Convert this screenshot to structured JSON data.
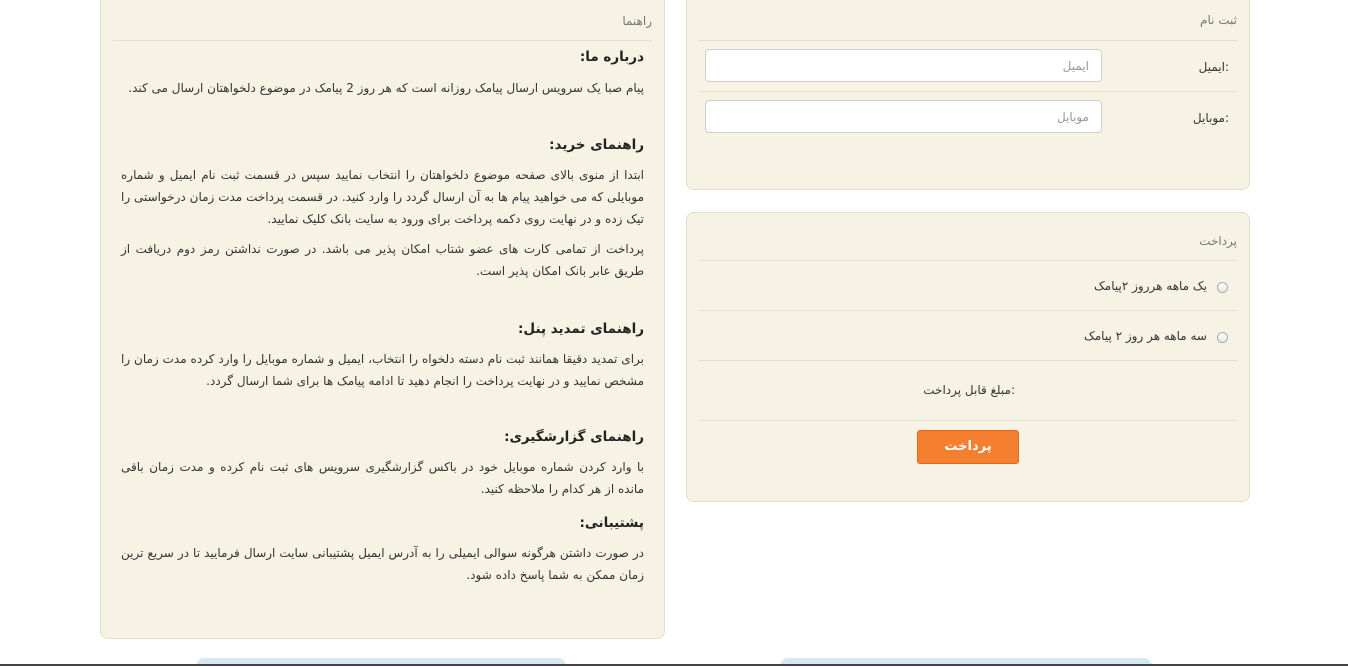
{
  "signup": {
    "title": "ثبت نام",
    "email_label": "ایمیل:",
    "email_placeholder": "ایمیل",
    "mobile_label": "موبایل:",
    "mobile_placeholder": "موبایل"
  },
  "payment": {
    "title": "پرداخت",
    "options": [
      "یک ماهه هرروز ۲پیامک",
      "سه ماهه هر روز ۲ پیامک"
    ],
    "amount_label": "مبلغ قابل پرداخت:",
    "pay_button": "پرداخت"
  },
  "guide": {
    "title": "راهنما",
    "about_heading": "درباره ما:",
    "about_text": "پیام صبا یک سرویس ارسال پیامک روزانه است که هر روز 2 پیامک در موضوع دلخواهتان ارسال می کند.",
    "buy_heading": "راهنمای خرید:",
    "buy_text_1": "ابتدا از منوی بالای صفحه موضوع دلخواهتان را انتخاب نمایید سپس در قسمت ثبت نام ایمیل و شماره موبایلی که می خواهید پیام ها به آن ارسال گردد را وارد کنید. در قسمت پرداخت مدت زمان درخواستی را تیک زده و در نهایت روی دکمه پرداخت برای ورود به سایت بانک کلیک نمایید.",
    "buy_text_2": "پرداخت از تمامی کارت های عضو شتاب امکان پذیر می باشد. در صورت نداشتن رمز دوم دریافت از طریق عابر بانک امکان پذیر است.",
    "renew_heading": "راهنمای تمدید پنل:",
    "renew_text": "برای تمدید دقیقا همانند ثبت نام دسته دلخواه را انتخاب، ایمیل و شماره موبایل را وارد کرده مدت زمان را مشخص نمایید و در نهایت پرداخت را انجام دهید تا ادامه پیامک ها برای شما ارسال گردد.",
    "report_heading": "راهنمای گزارشگیری:",
    "report_text": "با وارد کردن شماره موبایل خود در باکس گزارشگیری سرویس های ثبت نام کرده و مدت زمان باقی مانده از هر کدام را ملاحظه کنید.",
    "support_heading": "پشتیبانی:",
    "support_text": "در صورت داشتن هرگونه سوالی ایمیلی را به آدرس ایمیل پشتیبانی سایت ارسال فرمایید تا در سریع ترین زمان ممکن به شما پاسخ داده شود."
  }
}
